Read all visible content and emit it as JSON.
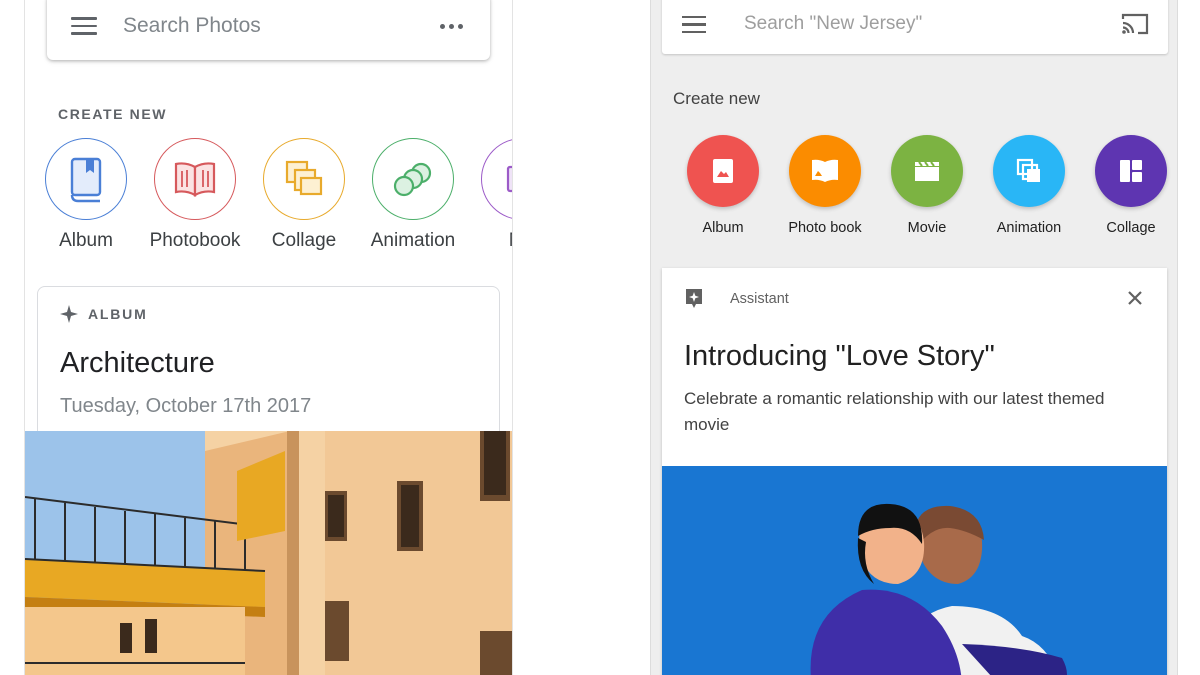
{
  "left": {
    "search": {
      "placeholder": "Search Photos"
    },
    "create_new_label": "CREATE NEW",
    "create_items": [
      {
        "label": "Album",
        "icon": "book-icon",
        "color": "#4a7fd6"
      },
      {
        "label": "Photobook",
        "icon": "open-book-icon",
        "color": "#d6595c"
      },
      {
        "label": "Collage",
        "icon": "collage-icon",
        "color": "#e8aa2c"
      },
      {
        "label": "Animation",
        "icon": "animation-icon",
        "color": "#4caf6a"
      },
      {
        "label": "Mo",
        "icon": "movie-icon",
        "color": "#9c5bc8"
      }
    ],
    "card": {
      "kind": "ALBUM",
      "title": "Architecture",
      "date": "Tuesday, October 17th 2017"
    }
  },
  "right": {
    "search": {
      "placeholder": "Search \"New Jersey\""
    },
    "create_new_label": "Create new",
    "create_items": [
      {
        "label": "Album",
        "icon": "photo-icon",
        "color": "#ef5350"
      },
      {
        "label": "Photo book",
        "icon": "book-icon",
        "color": "#fb8c00"
      },
      {
        "label": "Movie",
        "icon": "clapper-icon",
        "color": "#7cb342"
      },
      {
        "label": "Animation",
        "icon": "animation-icon",
        "color": "#29b6f6"
      },
      {
        "label": "Collage",
        "icon": "collage-icon",
        "color": "#5e35b1"
      }
    ],
    "card": {
      "kind": "Assistant",
      "title": "Introducing \"Love Story\"",
      "body": "Celebrate a romantic relationship with our latest themed movie"
    }
  }
}
